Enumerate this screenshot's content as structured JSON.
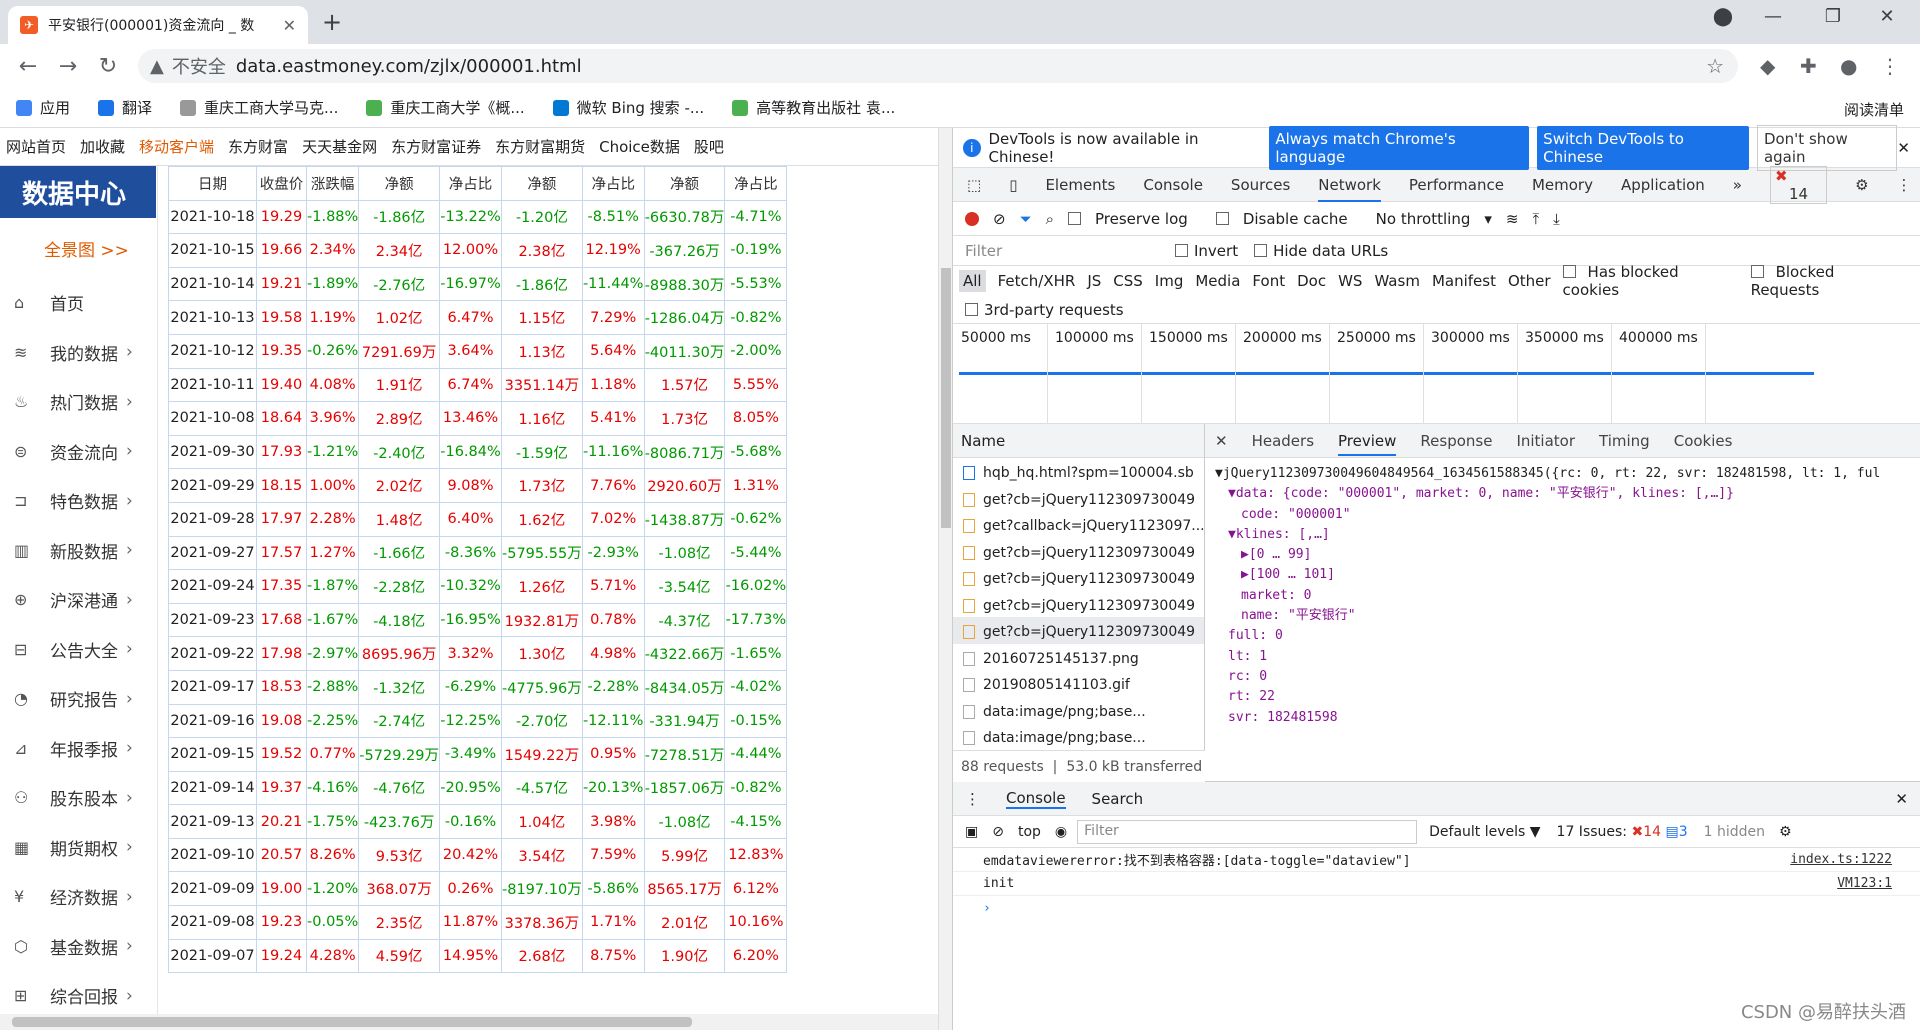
{
  "browser": {
    "tab_title": "平安银行(000001)资金流向 _ 数",
    "nav_hint": "不安全",
    "url": "data.eastmoney.com/zjlx/000001.html"
  },
  "bookmarks": [
    "应用",
    "翻译",
    "重庆工商大学马克...",
    "重庆工商大学《概...",
    "微软 Bing 搜索 -...",
    "高等教育出版社 袁..."
  ],
  "reading_list": "阅读清单",
  "topnav": [
    "网站首页",
    "加收藏",
    "移动客户端",
    "东方财富",
    "天天基金网",
    "东方财富证券",
    "东方财富期货",
    "Choice数据",
    "股吧"
  ],
  "sidebar": {
    "logo": "数据中心",
    "quanjing": "全景图 >>",
    "items": [
      "首页",
      "我的数据",
      "热门数据",
      "资金流向",
      "特色数据",
      "新股数据",
      "沪深港通",
      "公告大全",
      "研究报告",
      "年报季报",
      "股东股本",
      "期货期权",
      "经济数据",
      "基金数据",
      "综合回报"
    ]
  },
  "table": {
    "headers": [
      "日期",
      "收盘价",
      "涨跌幅",
      "净额",
      "净占比",
      "净额",
      "净占比",
      "净额",
      "净占比"
    ],
    "rows": [
      [
        "2021-10-18",
        "19.29",
        "-1.88%",
        "-1.86亿",
        "-13.22%",
        "-1.20亿",
        "-8.51%",
        "-6630.78万",
        "-4.71%"
      ],
      [
        "2021-10-15",
        "19.66",
        "2.34%",
        "2.34亿",
        "12.00%",
        "2.38亿",
        "12.19%",
        "-367.26万",
        "-0.19%"
      ],
      [
        "2021-10-14",
        "19.21",
        "-1.89%",
        "-2.76亿",
        "-16.97%",
        "-1.86亿",
        "-11.44%",
        "-8988.30万",
        "-5.53%"
      ],
      [
        "2021-10-13",
        "19.58",
        "1.19%",
        "1.02亿",
        "6.47%",
        "1.15亿",
        "7.29%",
        "-1286.04万",
        "-0.82%"
      ],
      [
        "2021-10-12",
        "19.35",
        "-0.26%",
        "7291.69万",
        "3.64%",
        "1.13亿",
        "5.64%",
        "-4011.30万",
        "-2.00%"
      ],
      [
        "2021-10-11",
        "19.40",
        "4.08%",
        "1.91亿",
        "6.74%",
        "3351.14万",
        "1.18%",
        "1.57亿",
        "5.55%"
      ],
      [
        "2021-10-08",
        "18.64",
        "3.96%",
        "2.89亿",
        "13.46%",
        "1.16亿",
        "5.41%",
        "1.73亿",
        "8.05%"
      ],
      [
        "2021-09-30",
        "17.93",
        "-1.21%",
        "-2.40亿",
        "-16.84%",
        "-1.59亿",
        "-11.16%",
        "-8086.71万",
        "-5.68%"
      ],
      [
        "2021-09-29",
        "18.15",
        "1.00%",
        "2.02亿",
        "9.08%",
        "1.73亿",
        "7.76%",
        "2920.60万",
        "1.31%"
      ],
      [
        "2021-09-28",
        "17.97",
        "2.28%",
        "1.48亿",
        "6.40%",
        "1.62亿",
        "7.02%",
        "-1438.87万",
        "-0.62%"
      ],
      [
        "2021-09-27",
        "17.57",
        "1.27%",
        "-1.66亿",
        "-8.36%",
        "-5795.55万",
        "-2.93%",
        "-1.08亿",
        "-5.44%"
      ],
      [
        "2021-09-24",
        "17.35",
        "-1.87%",
        "-2.28亿",
        "-10.32%",
        "1.26亿",
        "5.71%",
        "-3.54亿",
        "-16.02%"
      ],
      [
        "2021-09-23",
        "17.68",
        "-1.67%",
        "-4.18亿",
        "-16.95%",
        "1932.81万",
        "0.78%",
        "-4.37亿",
        "-17.73%"
      ],
      [
        "2021-09-22",
        "17.98",
        "-2.97%",
        "8695.96万",
        "3.32%",
        "1.30亿",
        "4.98%",
        "-4322.66万",
        "-1.65%"
      ],
      [
        "2021-09-17",
        "18.53",
        "-2.88%",
        "-1.32亿",
        "-6.29%",
        "-4775.96万",
        "-2.28%",
        "-8434.05万",
        "-4.02%"
      ],
      [
        "2021-09-16",
        "19.08",
        "-2.25%",
        "-2.74亿",
        "-12.25%",
        "-2.70亿",
        "-12.11%",
        "-331.94万",
        "-0.15%"
      ],
      [
        "2021-09-15",
        "19.52",
        "0.77%",
        "-5729.29万",
        "-3.49%",
        "1549.22万",
        "0.95%",
        "-7278.51万",
        "-4.44%"
      ],
      [
        "2021-09-14",
        "19.37",
        "-4.16%",
        "-4.76亿",
        "-20.95%",
        "-4.57亿",
        "-20.13%",
        "-1857.06万",
        "-0.82%"
      ],
      [
        "2021-09-13",
        "20.21",
        "-1.75%",
        "-423.76万",
        "-0.16%",
        "1.04亿",
        "3.98%",
        "-1.08亿",
        "-4.15%"
      ],
      [
        "2021-09-10",
        "20.57",
        "8.26%",
        "9.53亿",
        "20.42%",
        "3.54亿",
        "7.59%",
        "5.99亿",
        "12.83%"
      ],
      [
        "2021-09-09",
        "19.00",
        "-1.20%",
        "368.07万",
        "0.26%",
        "-8197.10万",
        "-5.86%",
        "8565.17万",
        "6.12%"
      ],
      [
        "2021-09-08",
        "19.23",
        "-0.05%",
        "2.35亿",
        "11.87%",
        "3378.36万",
        "1.71%",
        "2.01亿",
        "10.16%"
      ],
      [
        "2021-09-07",
        "19.24",
        "4.28%",
        "4.59亿",
        "14.95%",
        "2.68亿",
        "8.75%",
        "1.90亿",
        "6.20%"
      ]
    ]
  },
  "devtools": {
    "info": "DevTools is now available in Chinese!",
    "btn1": "Always match Chrome's language",
    "btn2": "Switch DevTools to Chinese",
    "btn3": "Don't show again",
    "tabs": [
      "Elements",
      "Console",
      "Sources",
      "Network",
      "Performance",
      "Memory",
      "Application"
    ],
    "error_count": "14",
    "toolbar": {
      "preserve": "Preserve log",
      "cache": "Disable cache",
      "throttle": "No throttling"
    },
    "filter": "Filter",
    "invert": "Invert",
    "hide_data": "Hide data URLs",
    "types": [
      "All",
      "Fetch/XHR",
      "JS",
      "CSS",
      "Img",
      "Media",
      "Font",
      "Doc",
      "WS",
      "Wasm",
      "Manifest",
      "Other"
    ],
    "blocked_cookies": "Has blocked cookies",
    "blocked_req": "Blocked Requests",
    "third": "3rd-party requests",
    "ticks": [
      "50000 ms",
      "100000 ms",
      "150000 ms",
      "200000 ms",
      "250000 ms",
      "300000 ms",
      "350000 ms",
      "400000 ms"
    ],
    "name_header": "Name",
    "requests": [
      "hqb_hq.html?spm=100004.sb",
      "get?cb=jQuery112309730049",
      "get?callback=jQuery1123097...",
      "get?cb=jQuery112309730049",
      "get?cb=jQuery112309730049",
      "get?cb=jQuery112309730049",
      "get?cb=jQuery112309730049",
      "20160725145137.png",
      "20190805141103.gif",
      "data:image/png;base...",
      "data:image/png;base..."
    ],
    "footer_reqs": "88 requests",
    "footer_size": "53.0 kB transferred",
    "detail_tabs": [
      "Headers",
      "Preview",
      "Response",
      "Initiator",
      "Timing",
      "Cookies"
    ],
    "preview": [
      "▼jQuery112309730049604849564_1634561588345({rc: 0, rt: 22, svr: 182481598, lt: 1, ful",
      "▼data: {code: \"000001\", market: 0, name: \"平安银行\", klines: [,…]}",
      "code: \"000001\"",
      "▼klines: [,…]",
      "▶[0 … 99]",
      "▶[100 … 101]",
      "market: 0",
      "name: \"平安银行\"",
      "full: 0",
      "lt: 1",
      "rc: 0",
      "rt: 22",
      "svr: 182481598"
    ],
    "console_tabs": [
      "Console",
      "Search"
    ],
    "context": "top",
    "cfilter": "Filter",
    "levels": "Default levels ▼",
    "issues": "17 Issues:",
    "issue_err": "14",
    "issue_info": "3",
    "hidden": "1 hidden",
    "logs": [
      {
        "msg": "emdataviewererror:找不到表格容器:[data-toggle=\"dataview\"]",
        "src": "index.ts:1222"
      },
      {
        "msg": "init",
        "src": "VM123:1"
      }
    ]
  },
  "watermark": "CSDN @易醉扶头酒"
}
